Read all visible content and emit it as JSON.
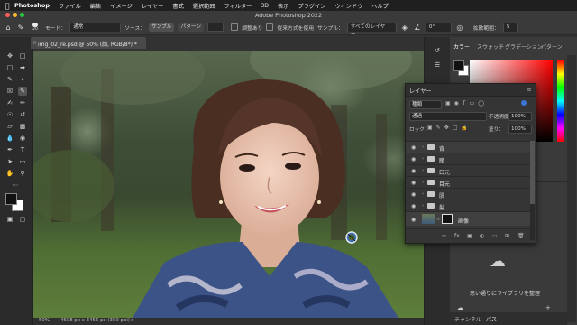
{
  "menubar": {
    "app_name": "Photoshop",
    "items": [
      "ファイル",
      "編集",
      "イメージ",
      "レイヤー",
      "書式",
      "選択範囲",
      "フィルター",
      "3D",
      "表示",
      "プラグイン",
      "ウィンドウ",
      "ヘルプ"
    ]
  },
  "window": {
    "title": "Adobe Photoshop 2022"
  },
  "options": {
    "brush_size": "20",
    "mode_label": "モード：",
    "mode_value": "通常",
    "source_label": "ソース：",
    "source_sampled": "サンプル",
    "source_pattern": "パターン",
    "aligned_label": "調整あり",
    "legacy_label": "従来方式を使用",
    "sample_label": "サンプル：",
    "sample_value": "すべてのレイヤー",
    "angle_value": "0°",
    "diffusion_label": "拡散範囲：",
    "diffusion_value": "5"
  },
  "document": {
    "tab_label": "img_02_re.psd @ 50% (顔, RGB/8*) *"
  },
  "status": {
    "zoom": "50%",
    "info": "4608 px x 3456 px (350 ppi)"
  },
  "right_panel": {
    "tabs": [
      "カラー",
      "スウォッチ",
      "グラデーション",
      "パターン"
    ],
    "library_message": "思い通りにライブラリを整理",
    "bottom_tabs": [
      "チャンネル",
      "パス"
    ]
  },
  "colors": {
    "foreground": "#111111",
    "background": "#ffffff",
    "accent": "#3d74d6"
  },
  "layers_panel": {
    "title": "レイヤー",
    "filter_kind": "種類",
    "blend_mode": "通過",
    "opacity_label": "不透明度：",
    "opacity_value": "100%",
    "lock_label": "ロック：",
    "fill_label": "塗り：",
    "fill_value": "100%",
    "layers": [
      {
        "name": "背"
      },
      {
        "name": "瞳"
      },
      {
        "name": "口元"
      },
      {
        "name": "目元"
      },
      {
        "name": "肌"
      },
      {
        "name": "髪"
      },
      {
        "name": "画像"
      }
    ]
  }
}
